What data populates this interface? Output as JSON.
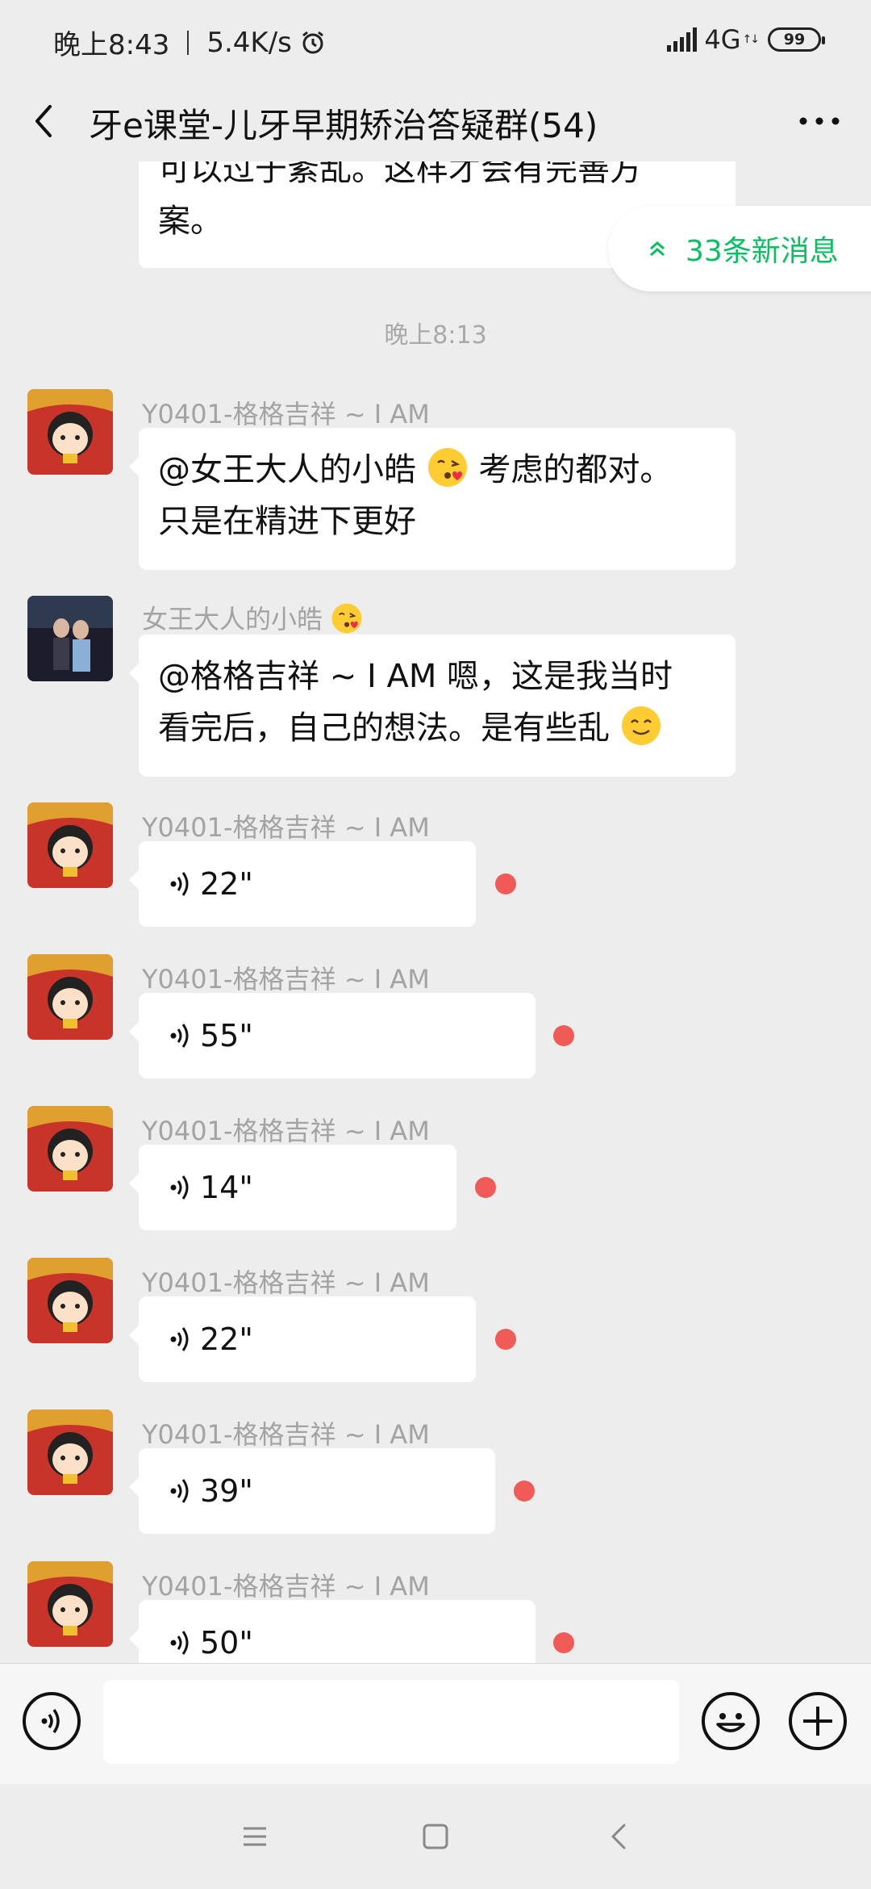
{
  "status_bar": {
    "time": "晚上8:43",
    "speed": "5.4K/s",
    "network": "4G",
    "net_arrows": "↑↓",
    "battery": "99"
  },
  "header": {
    "title": "牙e课堂-儿牙早期矫治答疑群(54)"
  },
  "chat": {
    "partial_message": {
      "line1": "可以过于紊乱。这样才会有完善方",
      "line2": "案。"
    },
    "new_messages_pill": "33条新消息",
    "timestamp": "晚上8:13",
    "messages": [
      {
        "sender": "Y0401-格格吉祥 ~ I AM",
        "line1_a": "@女王大人的小皓",
        "line1_b": "考虑的都对。",
        "line2": "只是在精进下更好"
      },
      {
        "sender": "女王大人的小皓",
        "line1": "@格格吉祥 ~ I AM  嗯，这是我当时",
        "line2": "看完后，自己的想法。是有些乱"
      }
    ],
    "voice_messages": [
      {
        "sender": "Y0401-格格吉祥 ~ I AM",
        "duration": "22\""
      },
      {
        "sender": "Y0401-格格吉祥 ~ I AM",
        "duration": "55\""
      },
      {
        "sender": "Y0401-格格吉祥 ~ I AM",
        "duration": "14\""
      },
      {
        "sender": "Y0401-格格吉祥 ~ I AM",
        "duration": "22\""
      },
      {
        "sender": "Y0401-格格吉祥 ~ I AM",
        "duration": "39\""
      },
      {
        "sender": "Y0401-格格吉祥 ~ I AM",
        "duration": "50\""
      }
    ]
  },
  "input_bar": {
    "placeholder": ""
  },
  "colors": {
    "accent": "#07c160",
    "unread_dot": "#f05b58",
    "bubble": "#ffffff",
    "background": "#ededed"
  }
}
